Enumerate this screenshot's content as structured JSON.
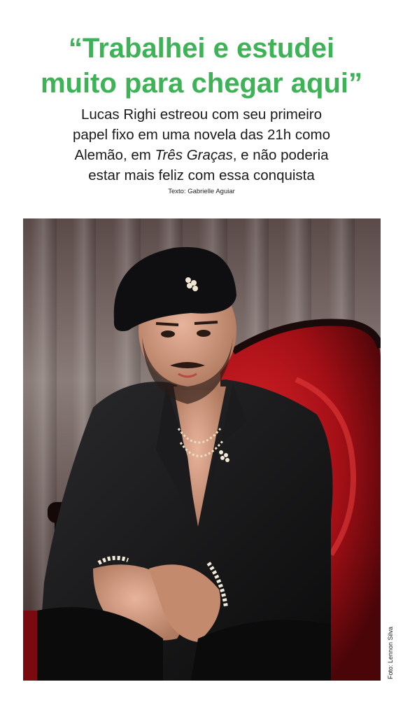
{
  "article": {
    "headline_line1": "“Trabalhei e estudei",
    "headline_line2": "muito para chegar aqui”",
    "subhead": {
      "line1": "Lucas Righi estreou com seu primeiro",
      "line2": "papel fixo em uma novela das 21h como",
      "line3_before": "Alemão, em ",
      "line3_italic": "Três Graças",
      "line3_after": ", e não poderia",
      "line4": "estar mais feliz com essa conquista"
    },
    "text_credit": "Texto: Gabrielle Aguiar",
    "photo_credit": "Foto: Lennon Silva"
  },
  "colors": {
    "headline": "#3db256",
    "body_text": "#1a1a1a",
    "chair_red": "#b3121a"
  }
}
